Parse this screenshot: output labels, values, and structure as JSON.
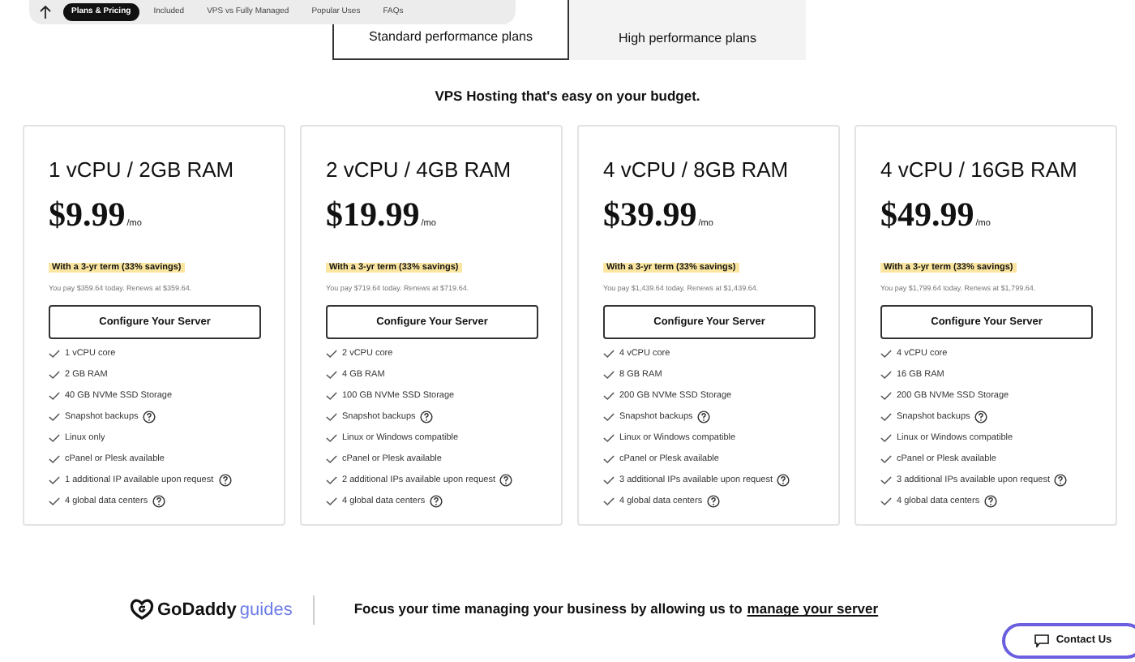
{
  "nav": {
    "items": [
      {
        "label": "Plans & Pricing",
        "selected": true
      },
      {
        "label": "Included",
        "selected": false
      },
      {
        "label": "VPS vs Fully Managed",
        "selected": false
      },
      {
        "label": "Popular Uses",
        "selected": false
      },
      {
        "label": "FAQs",
        "selected": false
      }
    ]
  },
  "plan_tabs": [
    {
      "label": "Standard performance plans",
      "selected": true
    },
    {
      "label": "High performance plans",
      "selected": false
    }
  ],
  "headline": "VPS Hosting that's easy on your budget.",
  "plans": [
    {
      "name": "1 vCPU / 2GB RAM",
      "price": "$9.99",
      "per": "/mo",
      "term": "With a 3-yr term (33% savings)",
      "pay": "You pay $359.64 today. Renews at $359.64.",
      "button": "Configure Your Server",
      "features": [
        {
          "text": "1 vCPU core",
          "info": false
        },
        {
          "text": "2 GB RAM",
          "info": false
        },
        {
          "text": "40 GB NVMe SSD Storage",
          "info": false
        },
        {
          "text": "Snapshot backups",
          "info": true
        },
        {
          "text": "Linux only",
          "info": false
        },
        {
          "text": "cPanel or Plesk available",
          "info": false
        },
        {
          "text": "1 additional IP available upon request",
          "info": true
        },
        {
          "text": "4 global data centers",
          "info": true
        }
      ]
    },
    {
      "name": "2 vCPU / 4GB RAM",
      "price": "$19.99",
      "per": "/mo",
      "term": "With a 3-yr term (33% savings)",
      "pay": "You pay $719.64 today. Renews at $719.64.",
      "button": "Configure Your Server",
      "features": [
        {
          "text": "2 vCPU core",
          "info": false
        },
        {
          "text": "4 GB RAM",
          "info": false
        },
        {
          "text": "100 GB NVMe SSD Storage",
          "info": false
        },
        {
          "text": "Snapshot backups",
          "info": true
        },
        {
          "text": "Linux or Windows compatible",
          "info": false
        },
        {
          "text": "cPanel or Plesk available",
          "info": false
        },
        {
          "text": "2 additional IPs available upon request",
          "info": true
        },
        {
          "text": "4 global data centers",
          "info": true
        }
      ]
    },
    {
      "name": "4 vCPU / 8GB RAM",
      "price": "$39.99",
      "per": "/mo",
      "term": "With a 3-yr term (33% savings)",
      "pay": "You pay $1,439.64 today. Renews at $1,439.64.",
      "button": "Configure Your Server",
      "features": [
        {
          "text": "4 vCPU core",
          "info": false
        },
        {
          "text": "8 GB RAM",
          "info": false
        },
        {
          "text": "200 GB NVMe SSD Storage",
          "info": false
        },
        {
          "text": "Snapshot backups",
          "info": true
        },
        {
          "text": "Linux or Windows compatible",
          "info": false
        },
        {
          "text": "cPanel or Plesk available",
          "info": false
        },
        {
          "text": "3 additional IPs available upon request",
          "info": true
        },
        {
          "text": "4 global data centers",
          "info": true
        }
      ]
    },
    {
      "name": "4 vCPU / 16GB RAM",
      "price": "$49.99",
      "per": "/mo",
      "term": "With a 3-yr term (33% savings)",
      "pay": "You pay $1,799.64 today. Renews at $1,799.64.",
      "button": "Configure Your Server",
      "features": [
        {
          "text": "4 vCPU core",
          "info": false
        },
        {
          "text": "16 GB RAM",
          "info": false
        },
        {
          "text": "200 GB NVMe SSD Storage",
          "info": false
        },
        {
          "text": "Snapshot backups",
          "info": true
        },
        {
          "text": "Linux or Windows compatible",
          "info": false
        },
        {
          "text": "cPanel or Plesk available",
          "info": false
        },
        {
          "text": "3 additional IPs available upon request",
          "info": true
        },
        {
          "text": "4 global data centers",
          "info": true
        }
      ]
    }
  ],
  "footer": {
    "brand": "GoDaddy",
    "brand_suffix": "guides",
    "text": "Focus your time managing your business by allowing us to",
    "link": "manage your server"
  },
  "contact_button": "Contact Us"
}
